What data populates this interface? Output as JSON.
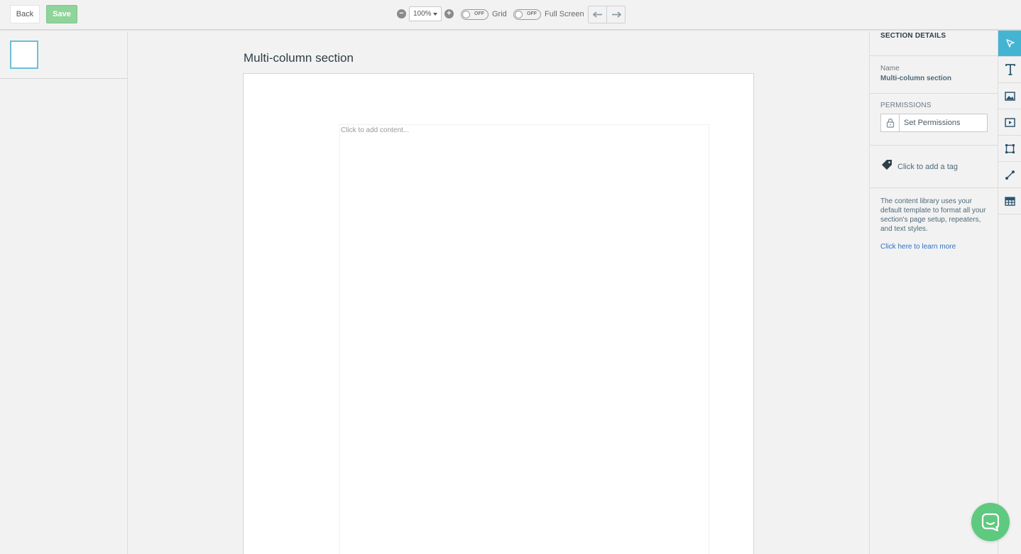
{
  "toolbar": {
    "back_label": "Back",
    "save_label": "Save",
    "zoom_value": "100%",
    "grid_toggle": {
      "state": "OFF",
      "label": "Grid"
    },
    "fullscreen_toggle": {
      "state": "OFF",
      "label": "Full Screen"
    }
  },
  "canvas": {
    "title": "Multi-column section",
    "placeholder": "Click to add content..."
  },
  "details": {
    "header": "SECTION DETAILS",
    "name_label": "Name",
    "name_value": "Multi-column section",
    "permissions_label": "PERMISSIONS",
    "permissions_button": "Set Permissions",
    "tag_label": "Click to add a tag",
    "info_text": "The content library uses your default template to format all your section's page setup, repeaters, and text styles.",
    "learn_more": "Click here to learn more"
  },
  "rail": {
    "tools": [
      "pointer-icon",
      "text-icon",
      "image-icon",
      "video-icon",
      "shape-icon",
      "line-icon",
      "table-icon"
    ],
    "active": "pointer-icon"
  },
  "colors": {
    "accent": "#45b4d3",
    "save_green": "#8fd49a",
    "chat_green": "#5ec97f",
    "link_blue": "#3270c6"
  }
}
